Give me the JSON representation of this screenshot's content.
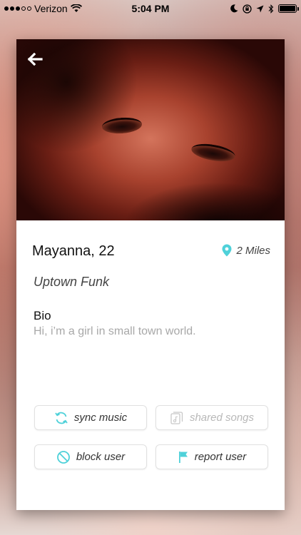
{
  "status_bar": {
    "carrier": "Verizon",
    "time": "5:04 PM"
  },
  "colors": {
    "accent": "#4fd1d9",
    "text_primary": "#111111",
    "text_muted": "#a8a8a8"
  },
  "profile": {
    "name_age": "Mayanna, 22",
    "distance": "2 Miles",
    "song": "Uptown Funk",
    "bio_label": "Bio",
    "bio_text": "Hi, i’m a girl in small town world."
  },
  "actions": {
    "sync_music": "sync music",
    "shared_songs": "shared songs",
    "block_user": "block user",
    "report_user": "report user"
  },
  "icons": {
    "back": "back-arrow-icon",
    "location": "location-pin-icon",
    "sync": "sync-icon",
    "shared": "shared-songs-icon",
    "block": "block-icon",
    "report": "flag-icon"
  }
}
